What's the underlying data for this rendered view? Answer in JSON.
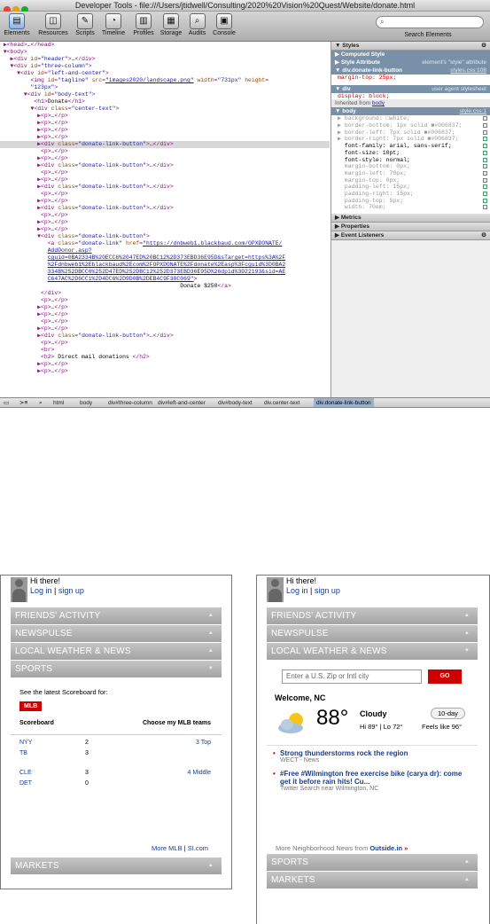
{
  "devtools": {
    "title": "Developer Tools - file:///Users/jtidwell/Consulting/2020%20Vision%20Quest/Website/donate.html",
    "toolbar": [
      "Elements",
      "Resources",
      "Scripts",
      "Timeline",
      "Profiles",
      "Storage",
      "Audits",
      "Console"
    ],
    "search_placeholder": "Search Elements",
    "search_label": "Search Elements",
    "code_lines": [
      [
        [
          "",
          2,
          "▶"
        ],
        [
          "t",
          "<head>"
        ],
        [
          "x",
          "…"
        ],
        [
          "t",
          "</head>"
        ]
      ],
      [
        [
          "",
          2,
          "▼"
        ],
        [
          "t",
          "<body>"
        ]
      ],
      [
        [
          "",
          4,
          "▶"
        ],
        [
          "t",
          "<div "
        ],
        [
          "n",
          "id"
        ],
        [
          "t",
          "="
        ],
        [
          "v",
          "\"header\""
        ],
        [
          "t",
          ">"
        ],
        [
          "x",
          "…"
        ],
        [
          "t",
          "</div>"
        ]
      ],
      [
        [
          "",
          4,
          "▼"
        ],
        [
          "t",
          "<div "
        ],
        [
          "n",
          "id"
        ],
        [
          "t",
          "="
        ],
        [
          "v",
          "\"three-column\""
        ],
        [
          "t",
          ">"
        ]
      ],
      [
        [
          "",
          6,
          "▼"
        ],
        [
          "t",
          "<div "
        ],
        [
          "n",
          "id"
        ],
        [
          "t",
          "="
        ],
        [
          "v",
          "\"left-and-center\""
        ],
        [
          "t",
          ">"
        ]
      ],
      [
        [
          "",
          9,
          ""
        ],
        [
          "t",
          "<img "
        ],
        [
          "n",
          "id"
        ],
        [
          "t",
          "="
        ],
        [
          "v",
          "\"tagline\" "
        ],
        [
          "n",
          "src"
        ],
        [
          "t",
          "="
        ],
        [
          "l",
          "\"images2020/landscape.png\""
        ],
        [
          "n",
          " width"
        ],
        [
          "t",
          "="
        ],
        [
          "v",
          "\"731px\""
        ],
        [
          "n",
          " height"
        ],
        [
          "t",
          "="
        ]
      ],
      [
        [
          "",
          9,
          ""
        ],
        [
          "v",
          "\"123px\""
        ],
        [
          "t",
          ">"
        ]
      ],
      [
        [
          "",
          8,
          "▼"
        ],
        [
          "t",
          "<div "
        ],
        [
          "n",
          "id"
        ],
        [
          "t",
          "="
        ],
        [
          "v",
          "\"body-text\""
        ],
        [
          "t",
          ">"
        ]
      ],
      [
        [
          "",
          10,
          ""
        ],
        [
          "t",
          "<h1>"
        ],
        [
          "x",
          "Donate"
        ],
        [
          "t",
          "</h1>"
        ]
      ],
      [
        [
          "",
          10,
          "▼"
        ],
        [
          "t",
          "<div "
        ],
        [
          "n",
          "class"
        ],
        [
          "t",
          "="
        ],
        [
          "v",
          "\"center-text\""
        ],
        [
          "t",
          ">"
        ]
      ],
      [
        [
          "",
          12,
          "▶"
        ],
        [
          "t",
          "<p>"
        ],
        [
          "x",
          "…"
        ],
        [
          "t",
          "</p>"
        ]
      ],
      [
        [
          "",
          12,
          "▶"
        ],
        [
          "t",
          "<p>"
        ],
        [
          "x",
          "…"
        ],
        [
          "t",
          "</p>"
        ]
      ],
      [
        [
          "",
          12,
          "▶"
        ],
        [
          "t",
          "<p>"
        ],
        [
          "x",
          "…"
        ],
        [
          "t",
          "</p>"
        ]
      ],
      [
        [
          "",
          12,
          "▶"
        ],
        [
          "t",
          "<p>"
        ],
        [
          "x",
          "…"
        ],
        [
          "t",
          "</p>"
        ]
      ],
      [
        [
          "s",
          12,
          "▶"
        ],
        [
          "t",
          "<div "
        ],
        [
          "n",
          "class"
        ],
        [
          "t",
          "="
        ],
        [
          "v",
          "\"donate-link-button\""
        ],
        [
          "t",
          ">"
        ],
        [
          "x",
          "…"
        ],
        [
          "t",
          "</div>"
        ]
      ],
      [
        [
          "",
          12,
          ""
        ],
        [
          "t",
          "<p>"
        ],
        [
          "x",
          "…"
        ],
        [
          "t",
          "</p>"
        ]
      ],
      [
        [
          "",
          12,
          "▶"
        ],
        [
          "t",
          "<p>"
        ],
        [
          "x",
          "…"
        ],
        [
          "t",
          "</p>"
        ]
      ],
      [
        [
          "",
          12,
          "▶"
        ],
        [
          "t",
          "<div "
        ],
        [
          "n",
          "class"
        ],
        [
          "t",
          "="
        ],
        [
          "v",
          "\"donate-link-button\""
        ],
        [
          "t",
          ">"
        ],
        [
          "x",
          "…"
        ],
        [
          "t",
          "</div>"
        ]
      ],
      [
        [
          "",
          12,
          ""
        ],
        [
          "t",
          "<p>"
        ],
        [
          "x",
          "…"
        ],
        [
          "t",
          "</p>"
        ]
      ],
      [
        [
          "",
          12,
          "▶"
        ],
        [
          "t",
          "<p>"
        ],
        [
          "x",
          "…"
        ],
        [
          "t",
          "</p>"
        ]
      ],
      [
        [
          "",
          12,
          "▶"
        ],
        [
          "t",
          "<div "
        ],
        [
          "n",
          "class"
        ],
        [
          "t",
          "="
        ],
        [
          "v",
          "\"donate-link-button\""
        ],
        [
          "t",
          ">"
        ],
        [
          "x",
          "…"
        ],
        [
          "t",
          "</div>"
        ]
      ],
      [
        [
          "",
          12,
          ""
        ],
        [
          "t",
          "<p>"
        ],
        [
          "x",
          "…"
        ],
        [
          "t",
          "</p>"
        ]
      ],
      [
        [
          "",
          12,
          "▶"
        ],
        [
          "t",
          "<p>"
        ],
        [
          "x",
          "…"
        ],
        [
          "t",
          "</p>"
        ]
      ],
      [
        [
          "",
          12,
          "▶"
        ],
        [
          "t",
          "<div "
        ],
        [
          "n",
          "class"
        ],
        [
          "t",
          "="
        ],
        [
          "v",
          "\"donate-link-button\""
        ],
        [
          "t",
          ">"
        ],
        [
          "x",
          "…"
        ],
        [
          "t",
          "</div>"
        ]
      ],
      [
        [
          "",
          12,
          ""
        ],
        [
          "t",
          "<p>"
        ],
        [
          "x",
          "…"
        ],
        [
          "t",
          "</p>"
        ]
      ],
      [
        [
          "",
          12,
          "▶"
        ],
        [
          "t",
          "<p>"
        ],
        [
          "x",
          "…"
        ],
        [
          "t",
          "</p>"
        ]
      ],
      [
        [
          "",
          12,
          "▶"
        ],
        [
          "t",
          "<p>"
        ],
        [
          "x",
          "…"
        ],
        [
          "t",
          "</p>"
        ]
      ],
      [
        [
          "",
          12,
          "▼"
        ],
        [
          "t",
          "<div "
        ],
        [
          "n",
          "class"
        ],
        [
          "t",
          "="
        ],
        [
          "v",
          "\"donate-link-button\""
        ],
        [
          "t",
          ">"
        ]
      ],
      [
        [
          "",
          14,
          ""
        ],
        [
          "t",
          "<a "
        ],
        [
          "n",
          "class"
        ],
        [
          "t",
          "="
        ],
        [
          "v",
          "\"donate-link\" "
        ],
        [
          "n",
          "href"
        ],
        [
          "t",
          "="
        ],
        [
          "l",
          "\"https://dnbweb1.blackbaud.com/OPXDONATE/"
        ]
      ],
      [
        [
          "",
          14,
          ""
        ],
        [
          "l",
          "AddDonor.asp?"
        ]
      ],
      [
        [
          "",
          14,
          ""
        ],
        [
          "l",
          "cguid=0BA2334B%20ECC6%2047ED%20BC12%2D373EBD36E95D&sTarget=https%3A%2F"
        ]
      ],
      [
        [
          "",
          14,
          ""
        ],
        [
          "l",
          "%2Fdnbweb1%2Eblackbaud%2Ecom%2FOPXDONATE%2Fdonate%2Easp%3Fcguid%3D0BA2"
        ]
      ],
      [
        [
          "",
          14,
          ""
        ],
        [
          "l",
          "334B%252DBCC6%252D47ED%252DBC12%252D373EBD36E95D%26dpid%3D22193&sid=AE"
        ]
      ],
      [
        [
          "",
          14,
          ""
        ],
        [
          "l",
          "C647AC%2D6CC1%2D4DC6%2D9D0B%2DEB4C9F30C069\""
        ],
        [
          "t",
          ">"
        ]
      ],
      [
        [
          "",
          53,
          ""
        ],
        [
          "x",
          "Donate $250"
        ],
        [
          "t",
          "</a>"
        ]
      ],
      [
        [
          "",
          12,
          ""
        ],
        [
          "t",
          "</div>"
        ]
      ],
      [
        [
          "",
          12,
          ""
        ],
        [
          "t",
          "<p>"
        ],
        [
          "x",
          "…"
        ],
        [
          "t",
          "</p>"
        ]
      ],
      [
        [
          "",
          12,
          "▶"
        ],
        [
          "t",
          "<p>"
        ],
        [
          "x",
          "…"
        ],
        [
          "t",
          "</p>"
        ]
      ],
      [
        [
          "",
          12,
          "▶"
        ],
        [
          "t",
          "<p>"
        ],
        [
          "x",
          "…"
        ],
        [
          "t",
          "</p>"
        ]
      ],
      [
        [
          "",
          12,
          ""
        ],
        [
          "t",
          "<p>"
        ],
        [
          "x",
          "…"
        ],
        [
          "t",
          "</p>"
        ]
      ],
      [
        [
          "",
          12,
          "▶"
        ],
        [
          "t",
          "<p>"
        ],
        [
          "x",
          "…"
        ],
        [
          "t",
          "</p>"
        ]
      ],
      [
        [
          "",
          12,
          "▶"
        ],
        [
          "t",
          "<div "
        ],
        [
          "n",
          "class"
        ],
        [
          "t",
          "="
        ],
        [
          "v",
          "\"donate-link-button\""
        ],
        [
          "t",
          ">"
        ],
        [
          "x",
          "…"
        ],
        [
          "t",
          "</div>"
        ]
      ],
      [
        [
          "",
          12,
          ""
        ],
        [
          "t",
          "<p>"
        ],
        [
          "x",
          "…"
        ],
        [
          "t",
          "</p>"
        ]
      ],
      [
        [
          "",
          12,
          ""
        ],
        [
          "t",
          "<br>"
        ]
      ],
      [
        [
          "",
          12,
          ""
        ],
        [
          "t",
          "<h2>"
        ],
        [
          "x",
          " Direct mail donations "
        ],
        [
          "t",
          "</h2>"
        ]
      ],
      [
        [
          "",
          12,
          "▶"
        ],
        [
          "t",
          "<p>"
        ],
        [
          "x",
          "…"
        ],
        [
          "t",
          "</p>"
        ]
      ],
      [
        [
          "",
          12,
          "▶"
        ],
        [
          "t",
          "<p>"
        ],
        [
          "x",
          "…"
        ],
        [
          "t",
          "</p>"
        ]
      ]
    ],
    "sidebar": {
      "styles_header": "Styles",
      "computed_style": "Computed Style",
      "style_attribute": "Style Attribute",
      "style_attribute_note": "element's \"style\" attribute",
      "rule1_selector": "div.donate-link-button",
      "rule1_source": "styles.css:108",
      "rule1_prop": "margin-top: 25px;",
      "rule2_selector": "div",
      "rule2_source": "user agent stylesheet",
      "rule2_prop": "display: block;",
      "inherited_prefix": "Inherited from",
      "inherited_link": "body",
      "rule3_selector": "body",
      "rule3_source": "style.css:1",
      "props": [
        {
          "t": "▶ background: □white;",
          "d": true
        },
        {
          "t": "▶ border-bottom: 1px solid ■#006837;",
          "d": true
        },
        {
          "t": "▶ border-left: 7px solid ■#006837;",
          "d": true
        },
        {
          "t": "▶ border-right: 7px solid ■#006837;",
          "d": true
        },
        {
          "t": "  font-family: arial, sans-serif;",
          "d": false
        },
        {
          "t": "  font-size: 10pt;",
          "d": false
        },
        {
          "t": "  font-style: normal;",
          "d": false
        },
        {
          "t": "  margin-bottom: 0px;",
          "d": true
        },
        {
          "t": "  margin-left: 70px;",
          "d": true
        },
        {
          "t": "  margin-top: 0px;",
          "d": true
        },
        {
          "t": "  padding-left: 15px;",
          "d": true
        },
        {
          "t": "  padding-right: 15px;",
          "d": true
        },
        {
          "t": "  padding-top: 5px;",
          "d": true
        },
        {
          "t": "  width: 70em;",
          "d": true
        }
      ],
      "metrics": "Metrics",
      "properties": "Properties",
      "event_listeners": "Event Listeners"
    },
    "breadcrumbs": [
      "html",
      "body",
      "div#three-column",
      "div#left-and-center",
      "div#body-text",
      "div.center-text",
      "div.donate-link-button"
    ]
  },
  "left_phone": {
    "greeting": "Hi there!",
    "login": "Log in",
    "sep": "|",
    "signup": "sign up",
    "sections_top": [
      "FRIENDS' ACTIVITY",
      "NEWSPULSE",
      "LOCAL WEATHER & NEWS",
      "SPORTS"
    ],
    "scoreboard_intro": "See the latest Scoreboard for:",
    "mlb_button": "MLB",
    "scoreboard_label": "Scoreboard",
    "choose_teams": "Choose my MLB teams",
    "games": [
      {
        "a": "NYY",
        "as": "2",
        "b": "TB",
        "bs": "3",
        "status": "3 Top"
      },
      {
        "a": "CLE",
        "as": "3",
        "b": "DET",
        "bs": "0",
        "status": "4 Middle"
      }
    ],
    "more_mlb": "More MLB",
    "si": "SI.com",
    "markets": "MARKETS"
  },
  "right_phone": {
    "greeting": "Hi there!",
    "login": "Log in",
    "sep": "|",
    "signup": "sign up",
    "sections_top": [
      "FRIENDS' ACTIVITY",
      "NEWSPULSE",
      "LOCAL WEATHER & NEWS"
    ],
    "zip_placeholder": "Enter a U.S. Zip or Intl city",
    "go": "GO",
    "welcome": "Welcome, NC",
    "temp": "88°",
    "condition": "Cloudy",
    "ten_day": "10-day",
    "hi": "Hi 89°",
    "lo": "Lo 72°",
    "feels": "Feels like 96°",
    "news": [
      {
        "headline": "Strong thunderstorms rock the region",
        "source": "WECT - News"
      },
      {
        "headline": "#Free #Wilmington free exercise bike (carya dr): come get it before rain hits! Cu...",
        "source": "Twitter Search near Wilmington, NC"
      }
    ],
    "more_news": "More Neighborhood News from",
    "more_news_site": "Outside.in",
    "sections_bottom": [
      "SPORTS",
      "MARKETS"
    ]
  }
}
